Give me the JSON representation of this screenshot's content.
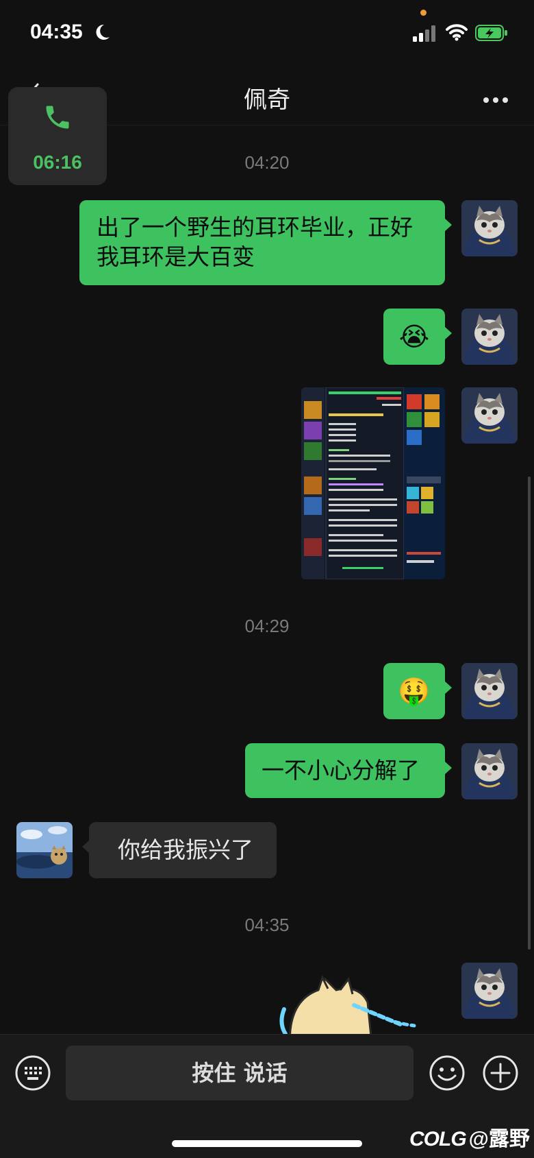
{
  "status": {
    "time": "04:35",
    "icons": [
      "moon-icon",
      "signal-icon",
      "wifi-icon",
      "battery-charging-icon"
    ]
  },
  "nav": {
    "title": "佩奇",
    "back_icon": "chevron-left-icon",
    "more_icon": "more-dots-icon"
  },
  "call": {
    "icon": "phone-icon",
    "duration": "06:16",
    "color": "#4cc162"
  },
  "messages": [
    {
      "type": "timestamp",
      "text": "04:20"
    },
    {
      "type": "text",
      "direction": "out",
      "text_lines": [
        "出了一个野生的耳环毕业，正好",
        "我耳环是大百变"
      ]
    },
    {
      "type": "emoji",
      "direction": "out",
      "emoji": "😭"
    },
    {
      "type": "image",
      "direction": "out",
      "description_icon": "game-item-tooltip-screenshot"
    },
    {
      "type": "timestamp",
      "text": "04:29"
    },
    {
      "type": "emoji",
      "direction": "out",
      "emoji": "🤑"
    },
    {
      "type": "text",
      "direction": "out",
      "text": "一不小心分解了"
    },
    {
      "type": "text",
      "direction": "in",
      "text": "你给我振兴了"
    },
    {
      "type": "timestamp",
      "text": "04:35"
    },
    {
      "type": "sticker",
      "direction": "out",
      "description_icon": "crying-cat-sticker"
    }
  ],
  "bottom": {
    "voice_label": "按住 说话",
    "icons": [
      "keyboard-icon",
      "emoji-icon",
      "plus-icon"
    ]
  },
  "watermark": {
    "logo": "COLG",
    "handle": "@露野"
  },
  "colors": {
    "background": "#111111",
    "outgoing_bubble": "#3dc25f",
    "incoming_bubble": "#2c2c2c",
    "accent": "#4cc162"
  }
}
